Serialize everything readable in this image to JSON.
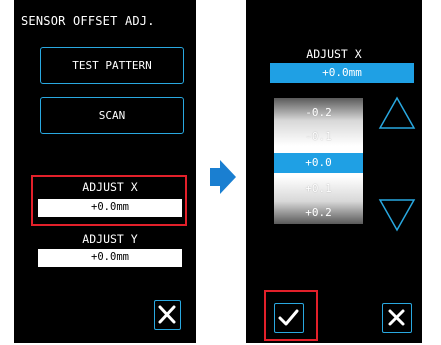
{
  "left_screen": {
    "title": "SENSOR OFFSET ADJ.",
    "test_pattern_label": "TEST PATTERN",
    "scan_label": "SCAN",
    "adjust_x_label": "ADJUST X",
    "adjust_x_value": "+0.0mm",
    "adjust_y_label": "ADJUST Y",
    "adjust_y_value": "+0.0mm",
    "close_icon": "close-icon"
  },
  "arrow": {
    "icon": "right-arrow-icon",
    "color": "#1a7fd1"
  },
  "right_screen": {
    "title": "ADJUST X",
    "current_value": "+0.0mm",
    "wheel_items": [
      "-0.2",
      "-0.1",
      "+0.0",
      "+0.1",
      "+0.2"
    ],
    "selected_index": 2,
    "up_icon": "triangle-up-icon",
    "down_icon": "triangle-down-icon",
    "confirm_icon": "checkmark-icon",
    "close_icon": "close-icon"
  },
  "colors": {
    "accent": "#1fa0e4",
    "highlight": "#e3202a",
    "background": "#000000"
  }
}
